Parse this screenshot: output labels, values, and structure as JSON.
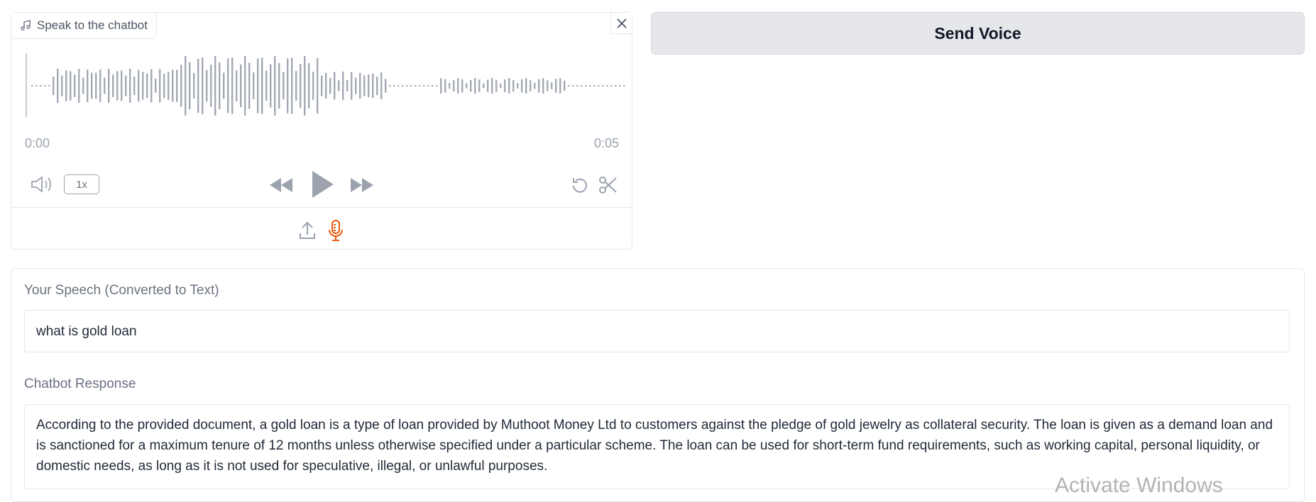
{
  "audio": {
    "label": "Speak to the chatbot",
    "time_start": "0:00",
    "time_end": "0:05",
    "speed": "1x",
    "accent_color": "#ea580c",
    "icons": [
      "music-note-icon",
      "close-icon",
      "volume-icon",
      "rewind-icon",
      "play-icon",
      "fast-forward-icon",
      "undo-icon",
      "scissors-icon",
      "upload-icon",
      "microphone-icon"
    ]
  },
  "send_button": {
    "label": "Send Voice"
  },
  "speech": {
    "label": "Your Speech (Converted to Text)",
    "value": "what is gold loan"
  },
  "response": {
    "label": "Chatbot Response",
    "value": "According to the provided document, a gold loan is a type of loan provided by Muthoot Money Ltd to customers against the pledge of gold jewelry as collateral security. The loan is given as a demand loan and is sanctioned for a maximum tenure of 12 months unless otherwise specified under a particular scheme. The loan can be used for short-term fund requirements, such as working capital, personal liquidity, or domestic needs, as long as it is not used for speculative, illegal, or unlawful purposes."
  },
  "watermark": "Activate Windows"
}
